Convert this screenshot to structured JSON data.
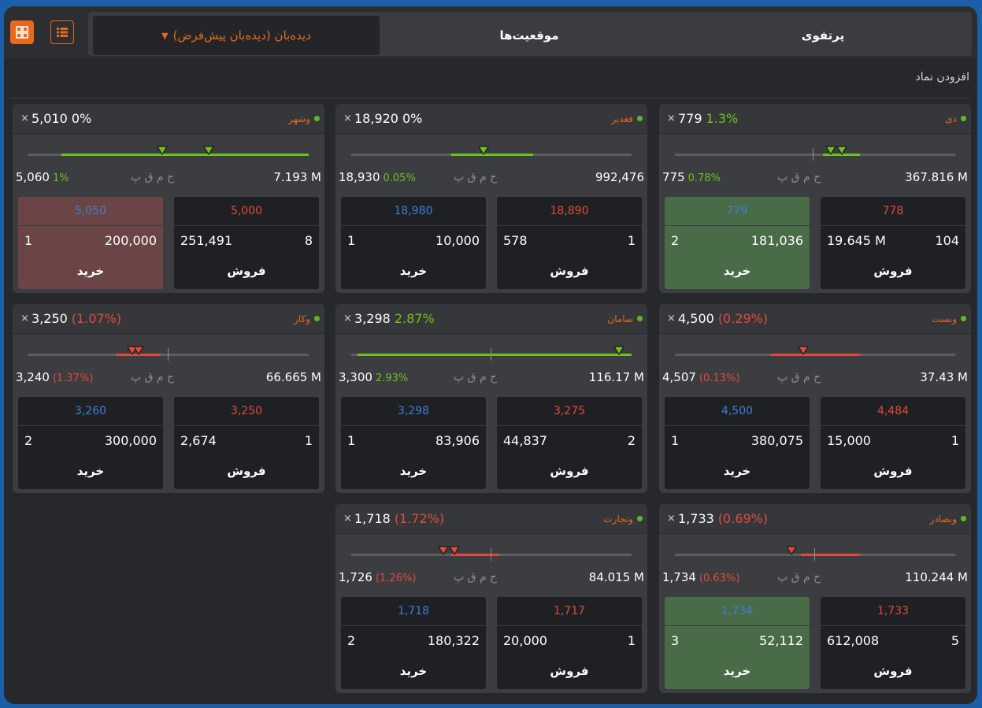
{
  "toolbar": {
    "grid_view_icon": "grid-icon",
    "list_view_icon": "list-icon",
    "accent": "#e8691c"
  },
  "tabs": {
    "watchlist_select": "دیده‌بان (دیده‌بان پیش‌فرض)",
    "positions": "موقعیت‌ها",
    "portfolio": "پرتفوی"
  },
  "add_symbol_label": "افزودن نماد",
  "colors": {
    "up": "#6ec21d",
    "down": "#e24a3b",
    "buy": "#3d7fd9",
    "sell": "#e24a3b"
  },
  "cards": [
    {
      "symbol": "دی",
      "last": "779",
      "last_change": "1.3%",
      "last_dir": "up",
      "close": "775",
      "close_change": "0.78%",
      "close_dir": "up",
      "labels": "ح م  ق پ",
      "volume": "367.816 M",
      "buy": {
        "price": "779",
        "count": "2",
        "volume": "181,036",
        "label": "خرید",
        "highlight": "green"
      },
      "sell": {
        "price": "778",
        "count": "104",
        "volume": "19.645 M",
        "label": "فروش"
      }
    },
    {
      "symbol": "فغدیر",
      "last": "18,920",
      "last_change": "0%",
      "last_dir": "flat",
      "close": "18,930",
      "close_change": "0.05%",
      "close_dir": "up",
      "labels": "ح م  ق پ",
      "volume": "992,476",
      "buy": {
        "price": "18,980",
        "count": "1",
        "volume": "10,000",
        "label": "خرید",
        "highlight": "none"
      },
      "sell": {
        "price": "18,890",
        "count": "1",
        "volume": "578",
        "label": "فروش"
      }
    },
    {
      "symbol": "وشهر",
      "last": "5,010",
      "last_change": "0%",
      "last_dir": "flat",
      "close": "5,060",
      "close_change": "1%",
      "close_dir": "up",
      "labels": "ح م  ق پ",
      "volume": "7.193 M",
      "buy": {
        "price": "5,050",
        "count": "1",
        "volume": "200,000",
        "label": "خرید",
        "highlight": "red"
      },
      "sell": {
        "price": "5,000",
        "count": "8",
        "volume": "251,491",
        "label": "فروش"
      }
    },
    {
      "symbol": "وبست",
      "last": "4,500",
      "last_change": "(0.29%)",
      "last_dir": "down",
      "close": "4,507",
      "close_change": "(0.13%)",
      "close_dir": "down",
      "labels": "ح م  ق پ",
      "volume": "37.43 M",
      "buy": {
        "price": "4,500",
        "count": "1",
        "volume": "380,075",
        "label": "خرید",
        "highlight": "none"
      },
      "sell": {
        "price": "4,484",
        "count": "1",
        "volume": "15,000",
        "label": "فروش"
      }
    },
    {
      "symbol": "سامان",
      "last": "3,298",
      "last_change": "2.87%",
      "last_dir": "up",
      "close": "3,300",
      "close_change": "2.93%",
      "close_dir": "up",
      "labels": "ح م  ق پ",
      "volume": "116.17 M",
      "buy": {
        "price": "3,298",
        "count": "1",
        "volume": "83,906",
        "label": "خرید",
        "highlight": "none"
      },
      "sell": {
        "price": "3,275",
        "count": "2",
        "volume": "44,837",
        "label": "فروش"
      }
    },
    {
      "symbol": "وکار",
      "last": "3,250",
      "last_change": "(1.07%)",
      "last_dir": "down",
      "close": "3,240",
      "close_change": "(1.37%)",
      "close_dir": "down",
      "labels": "ح م  ق پ",
      "volume": "66.665 M",
      "buy": {
        "price": "3,260",
        "count": "2",
        "volume": "300,000",
        "label": "خرید",
        "highlight": "none"
      },
      "sell": {
        "price": "3,250",
        "count": "1",
        "volume": "2,674",
        "label": "فروش"
      }
    },
    {
      "symbol": "وبصادر",
      "last": "1,733",
      "last_change": "(0.69%)",
      "last_dir": "down",
      "close": "1,734",
      "close_change": "(0.63%)",
      "close_dir": "down",
      "labels": "ح م  ق پ",
      "volume": "110.244 M",
      "buy": {
        "price": "1,734",
        "count": "3",
        "volume": "52,112",
        "label": "خرید",
        "highlight": "green"
      },
      "sell": {
        "price": "1,733",
        "count": "5",
        "volume": "612,008",
        "label": "فروش"
      }
    },
    {
      "symbol": "وتجارت",
      "last": "1,718",
      "last_change": "(1.72%)",
      "last_dir": "down",
      "close": "1,726",
      "close_change": "(1.26%)",
      "close_dir": "down",
      "labels": "ح م  ق پ",
      "volume": "84.015 M",
      "buy": {
        "price": "1,718",
        "count": "2",
        "volume": "180,322",
        "label": "خرید",
        "highlight": "none"
      },
      "sell": {
        "price": "1,717",
        "count": "1",
        "volume": "20,000",
        "label": "فروش"
      }
    }
  ]
}
